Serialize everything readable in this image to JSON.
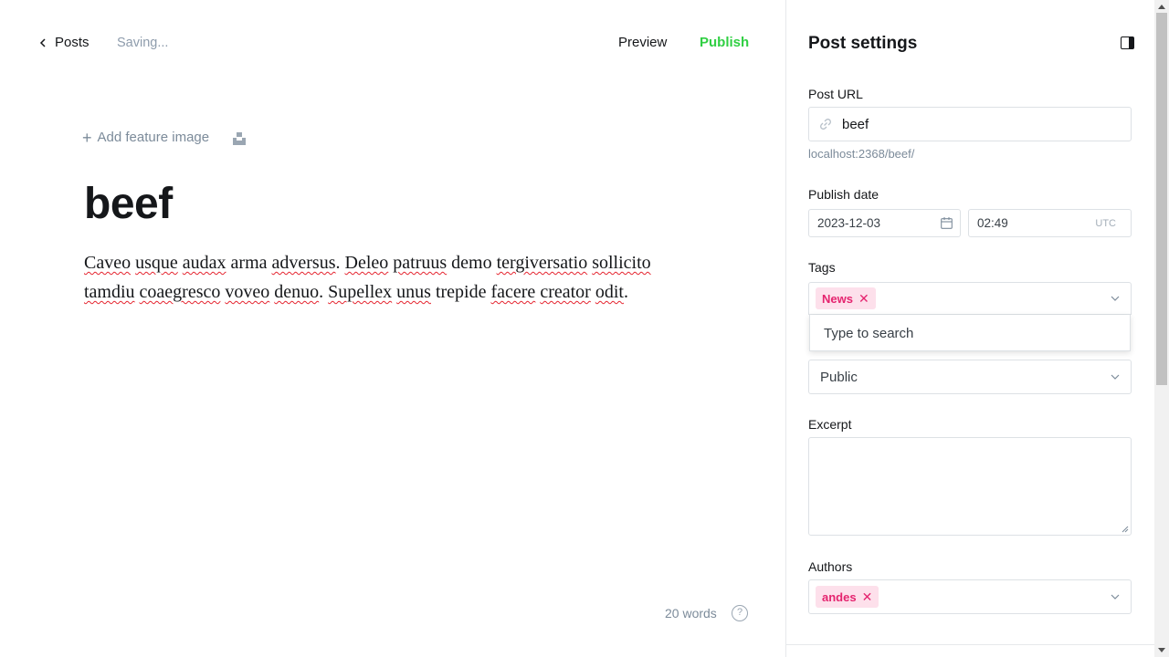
{
  "header": {
    "back_label": "Posts",
    "status": "Saving...",
    "preview_label": "Preview",
    "publish_label": "Publish"
  },
  "editor": {
    "add_feature_image": "Add feature image",
    "title": "beef",
    "body_words": [
      {
        "t": "Caveo",
        "sp": true
      },
      {
        "t": "usque",
        "sp": true
      },
      {
        "t": "audax",
        "sp": true
      },
      {
        "t": "arma",
        "sp": false
      },
      {
        "t": "adversus",
        "sp": true
      },
      {
        "t": ".",
        "sp": false,
        "nospace": true
      },
      {
        "t": "Deleo",
        "sp": true
      },
      {
        "t": "patruus",
        "sp": true
      },
      {
        "t": "demo",
        "sp": false
      },
      {
        "t": "tergiversatio",
        "sp": true
      },
      {
        "t": "sollicito",
        "sp": true
      },
      {
        "t": "tamdiu",
        "sp": true
      },
      {
        "t": "coaegresco",
        "sp": true
      },
      {
        "t": "voveo",
        "sp": true
      },
      {
        "t": "denuo",
        "sp": true
      },
      {
        "t": ".",
        "sp": false,
        "nospace": true
      },
      {
        "t": "Supellex",
        "sp": true
      },
      {
        "t": "unus",
        "sp": true
      },
      {
        "t": "trepide",
        "sp": false
      },
      {
        "t": "facere",
        "sp": true
      },
      {
        "t": "creator",
        "sp": true
      },
      {
        "t": "odit",
        "sp": true
      },
      {
        "t": ".",
        "sp": false,
        "nospace": true
      }
    ],
    "word_count": "20 words"
  },
  "sidebar": {
    "title": "Post settings",
    "post_url_label": "Post URL",
    "post_url_value": "beef",
    "post_url_hint": "localhost:2368/beef/",
    "publish_date_label": "Publish date",
    "publish_date": "2023-12-03",
    "publish_time": "02:49",
    "timezone": "UTC",
    "tags_label": "Tags",
    "tags": [
      "News"
    ],
    "tags_dropdown_option": "Type to search",
    "visibility_value": "Public",
    "excerpt_label": "Excerpt",
    "excerpt_value": "",
    "authors_label": "Authors",
    "authors": [
      "andes"
    ]
  },
  "colors": {
    "publish": "#30cf43",
    "chip_bg": "#fde0eb",
    "chip_text": "#e5246f",
    "muted": "#7c8b9a"
  }
}
